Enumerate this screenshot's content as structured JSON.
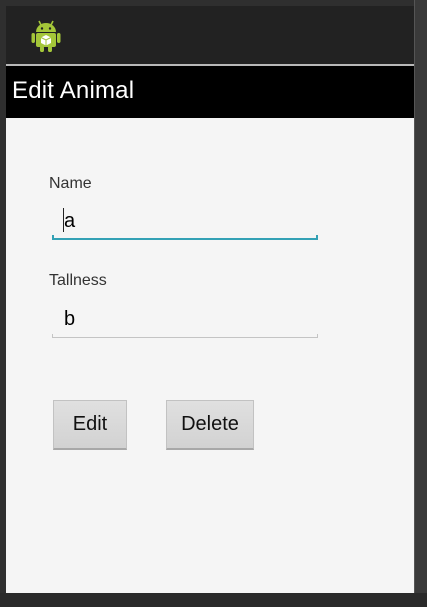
{
  "app_icon": "android-robot-icon",
  "title_bar": {
    "title": "Edit Animal"
  },
  "form": {
    "name_label": "Name",
    "name_value": "a",
    "tallness_label": "Tallness",
    "tallness_value": "b"
  },
  "buttons": {
    "edit_label": "Edit",
    "delete_label": "Delete"
  },
  "colors": {
    "accent": "#33a1b5",
    "title_bar_bg": "#000000",
    "content_bg": "#f5f5f5"
  }
}
